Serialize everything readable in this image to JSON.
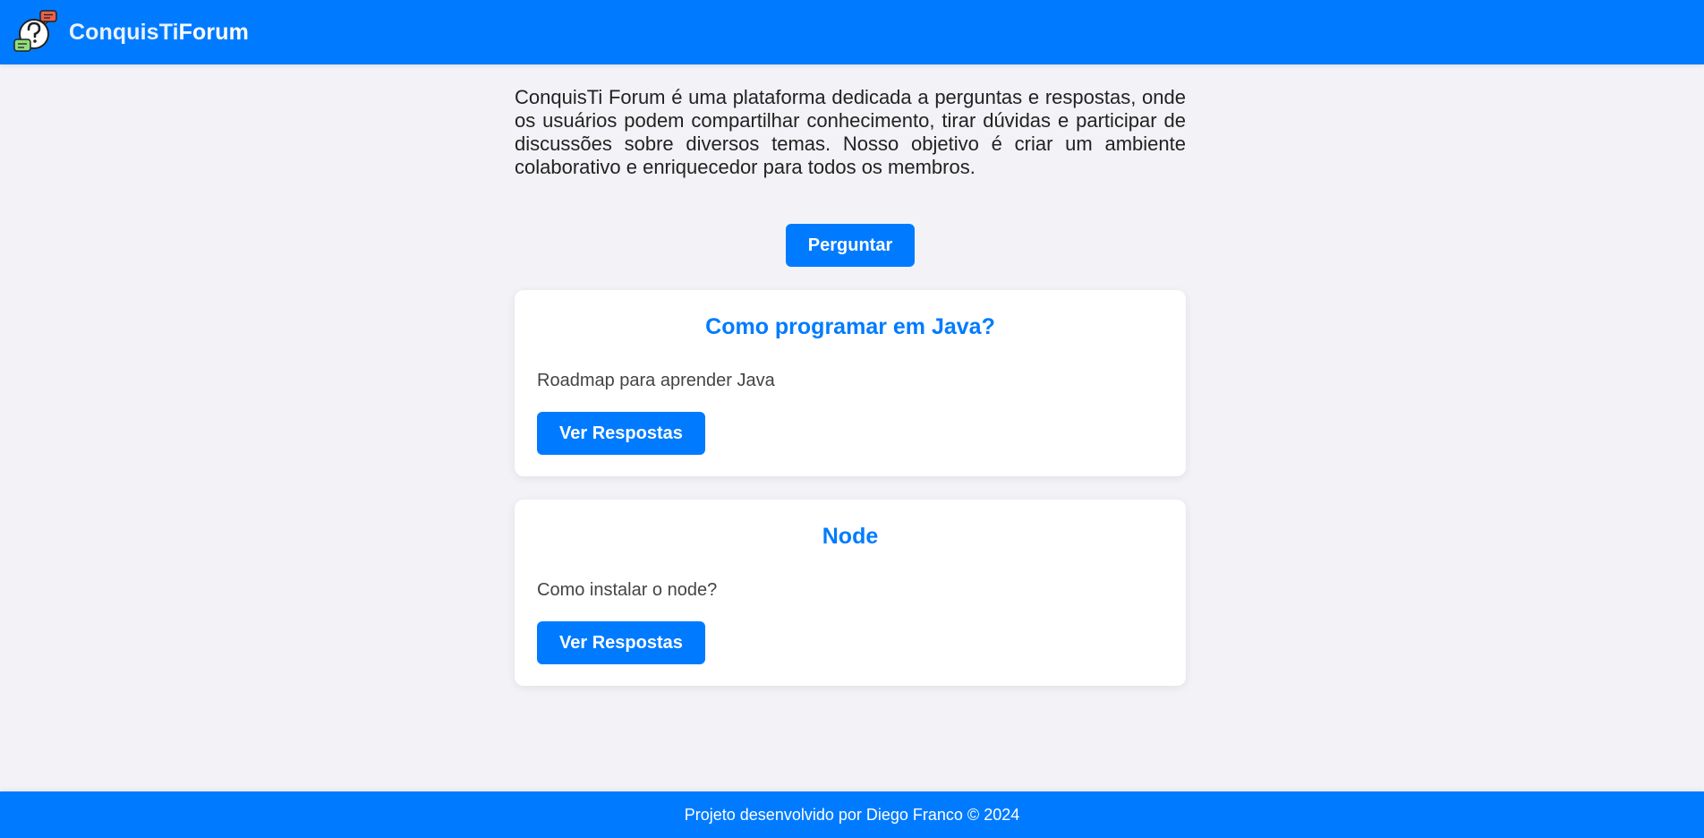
{
  "header": {
    "logo_icon": "question-chat-bubbles-icon",
    "brand_part1": "ConquisTi",
    "brand_part2": "Forum"
  },
  "intro": {
    "text": "ConquisTi Forum é uma plataforma dedicada a perguntas e respostas, onde os usuários podem compartilhar conhecimento, tirar dúvidas e participar de discussões sobre diversos temas. Nosso objetivo é criar um ambiente colaborativo e enriquecedor para todos os membros."
  },
  "actions": {
    "ask_label": "Perguntar"
  },
  "questions": [
    {
      "title": "Como programar em Java?",
      "description": "Roadmap para aprender Java",
      "button_label": "Ver Respostas"
    },
    {
      "title": "Node",
      "description": "Como instalar o node?",
      "button_label": "Ver Respostas"
    }
  ],
  "footer": {
    "text": "Projeto desenvolvido por Diego Franco © 2024"
  },
  "colors": {
    "primary": "#007bff",
    "background": "#f3f3f7",
    "card": "#ffffff"
  }
}
